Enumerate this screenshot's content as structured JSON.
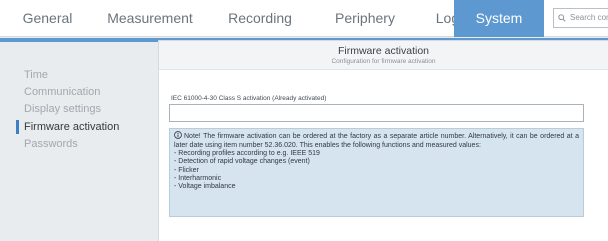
{
  "nav": {
    "tabs": [
      {
        "label": "General"
      },
      {
        "label": "Measurement"
      },
      {
        "label": "Recording"
      },
      {
        "label": "Periphery"
      },
      {
        "label": "Logic"
      },
      {
        "label": "System",
        "active": true
      }
    ],
    "search_placeholder": "Search conf"
  },
  "sidebar": {
    "items": [
      {
        "label": "Time"
      },
      {
        "label": "Communication"
      },
      {
        "label": "Display settings"
      },
      {
        "label": "Firmware activation",
        "active": true
      },
      {
        "label": "Passwords"
      }
    ]
  },
  "panel": {
    "title": "Firmware activation",
    "subtitle": "Configuration for firmware activation",
    "field_label": "IEC 61000-4-30 Class S activation (Already activated)",
    "field_value": "",
    "note": {
      "text": "Note! The firmware activation can be ordered at the factory as a separate article number. Alternatively, it can be ordered at a later date using item number 52.36.020. This enables the following functions and measured values:",
      "items": [
        "- Recording profiles according to e.g. IEEE 519",
        "- Detection of rapid voltage changes (event)",
        "- Flicker",
        "- Interharmonic",
        "- Voltage imbalance"
      ]
    }
  },
  "colors": {
    "accent": "#5d98d1",
    "active_marker": "#3b7fc4",
    "note_background": "#d6e4ef"
  },
  "icons": {
    "search": "search-icon",
    "note": "info-icon"
  }
}
